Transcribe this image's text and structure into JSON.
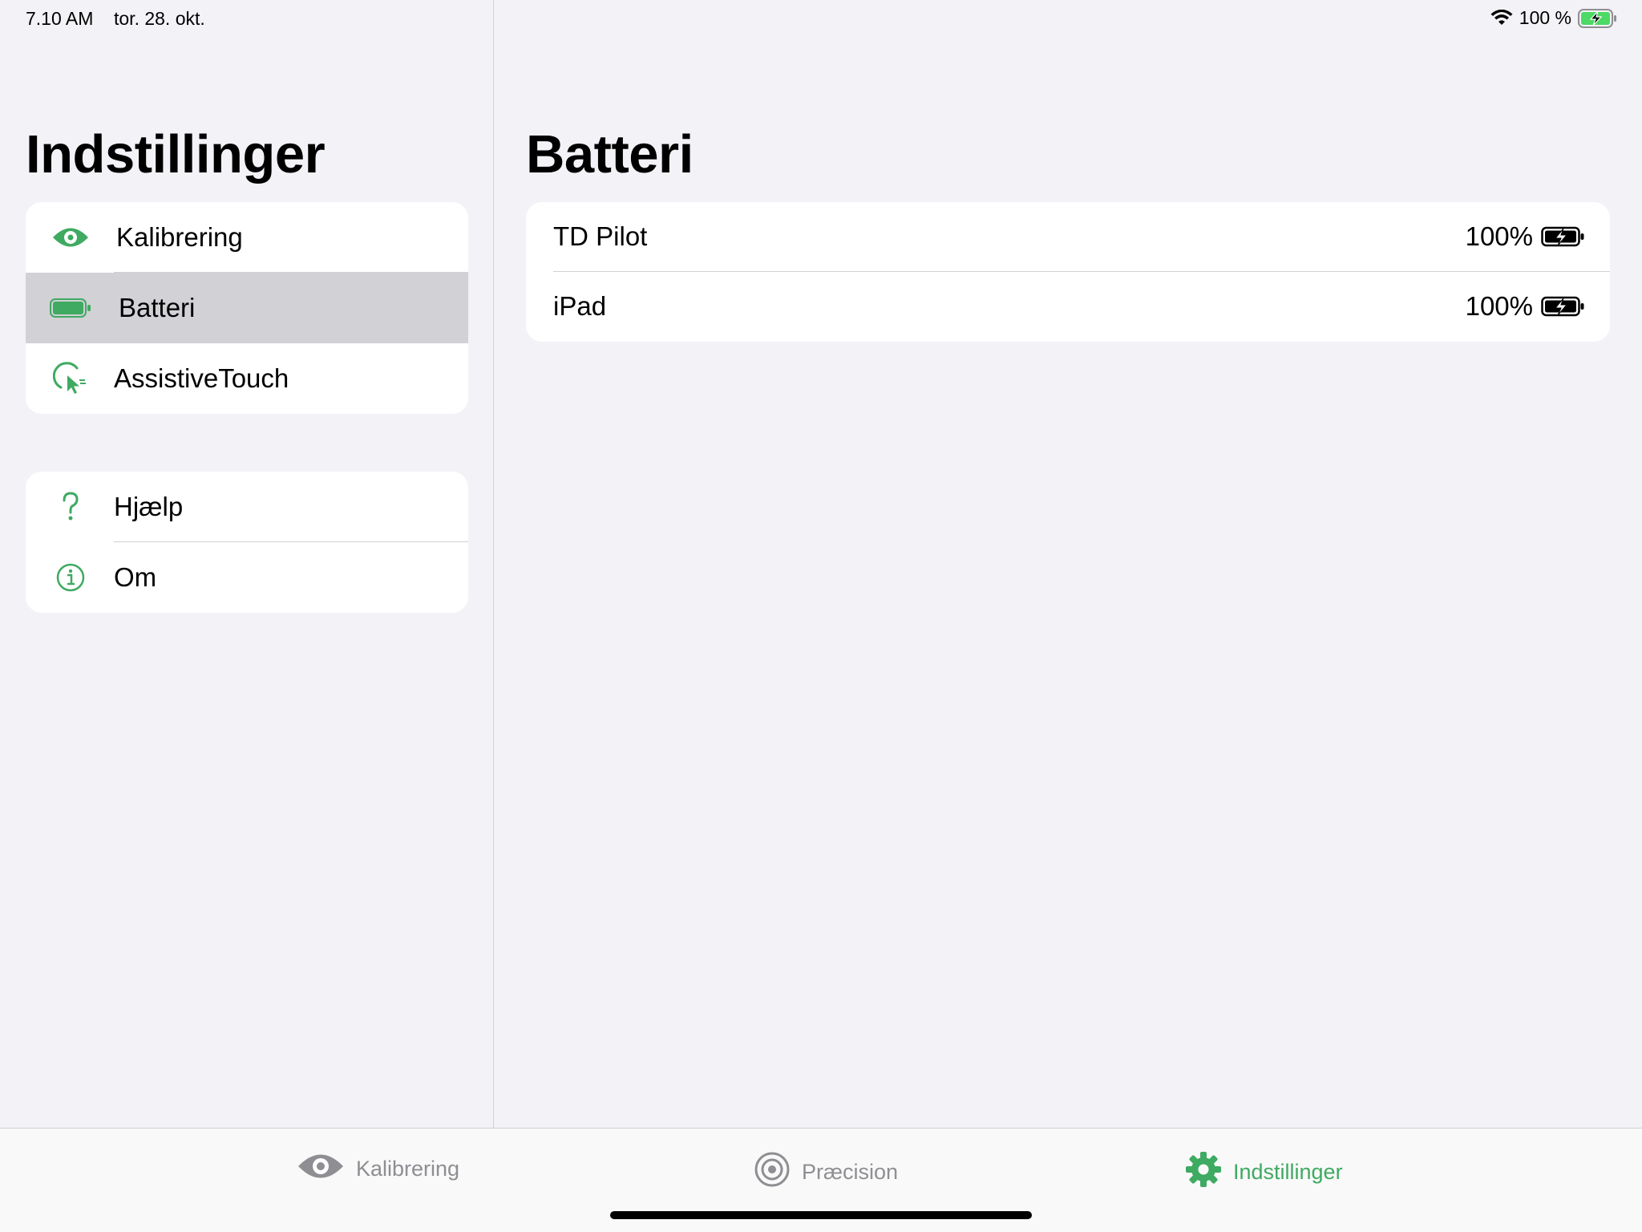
{
  "status_bar": {
    "time": "7.10 AM",
    "date": "tor. 28. okt.",
    "battery_text": "100 %"
  },
  "sidebar": {
    "title": "Indstillinger",
    "groups": [
      {
        "items": [
          {
            "label": "Kalibrering",
            "icon": "eye-icon",
            "selected": false
          },
          {
            "label": "Batteri",
            "icon": "battery-icon",
            "selected": true
          },
          {
            "label": "AssistiveTouch",
            "icon": "assistive-touch-icon",
            "selected": false
          }
        ]
      },
      {
        "items": [
          {
            "label": "Hjælp",
            "icon": "question-icon",
            "selected": false
          },
          {
            "label": "Om",
            "icon": "info-icon",
            "selected": false
          }
        ]
      }
    ]
  },
  "detail": {
    "title": "Batteri",
    "rows": [
      {
        "label": "TD Pilot",
        "value": "100%",
        "icon": "battery-charging-icon"
      },
      {
        "label": "iPad",
        "value": "100%",
        "icon": "battery-charging-icon"
      }
    ]
  },
  "tab_bar": {
    "tabs": [
      {
        "label": "Kalibrering",
        "icon": "eye-icon",
        "active": false
      },
      {
        "label": "Præcision",
        "icon": "target-icon",
        "active": false
      },
      {
        "label": "Indstillinger",
        "icon": "gear-icon",
        "active": true
      }
    ]
  },
  "colors": {
    "accent": "#3faa61",
    "background": "#f2f2f7",
    "selected_row": "#d1d1d6",
    "inactive_tab": "#8e8e93"
  }
}
